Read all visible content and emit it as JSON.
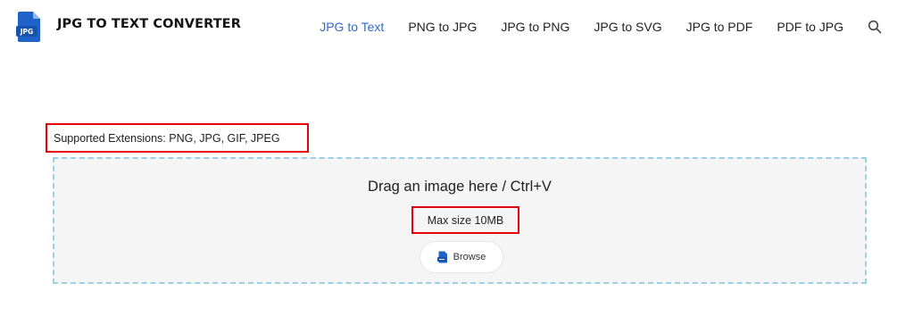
{
  "header": {
    "logo_text": "JPG",
    "brand_name": "JPG TO TEXT CONVERTER",
    "nav": [
      {
        "label": "JPG to Text",
        "active": true
      },
      {
        "label": "PNG to JPG",
        "active": false
      },
      {
        "label": "JPG to PNG",
        "active": false
      },
      {
        "label": "JPG to SVG",
        "active": false
      },
      {
        "label": "JPG to PDF",
        "active": false
      },
      {
        "label": "PDF to JPG",
        "active": false
      }
    ],
    "search_icon": "search-icon"
  },
  "upload": {
    "supported_extensions": "Supported Extensions: PNG, JPG, GIF, JPEG",
    "drop_text": "Drag an image here / Ctrl+V",
    "max_size": "Max size 10MB",
    "browse_label": "Browse",
    "browse_icon": "file-jpg-icon"
  },
  "colors": {
    "accent": "#2d6ac9",
    "highlight_border": "#e8000a",
    "dropzone_border": "#9cd0e6",
    "dropzone_bg": "#f5f5f5"
  }
}
